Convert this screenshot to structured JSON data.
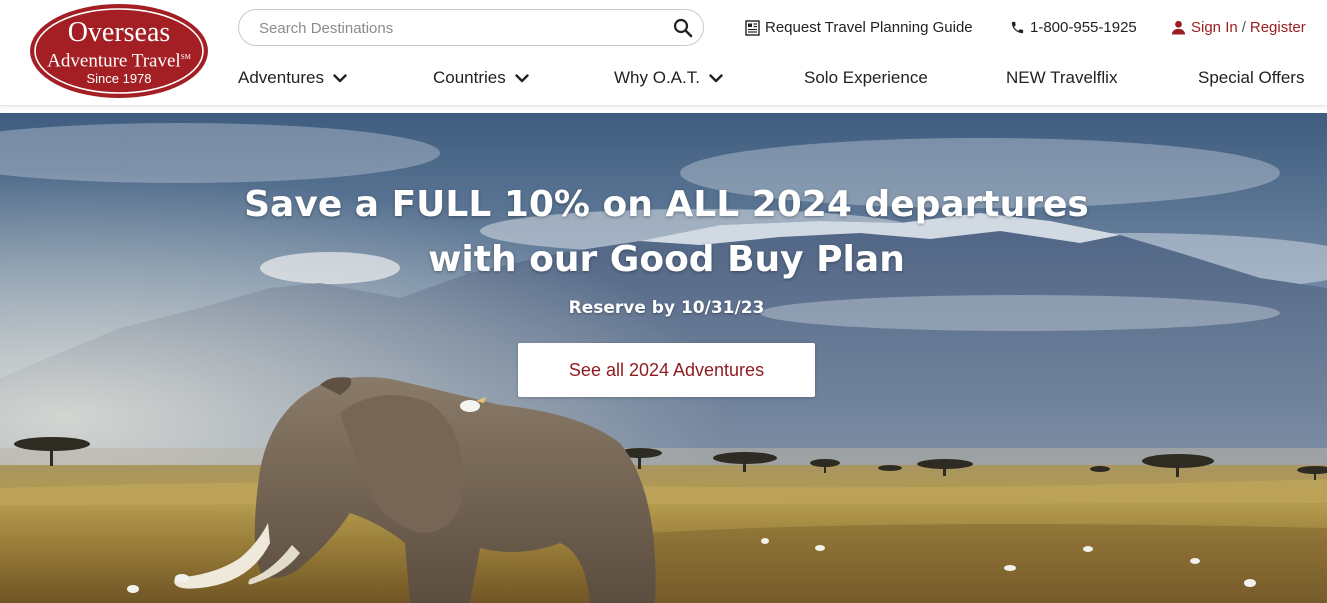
{
  "logo": {
    "line1": "Overseas",
    "line2": "Adventure Travel",
    "trademark": "SM",
    "line3": "Since 1978"
  },
  "search": {
    "placeholder": "Search Destinations",
    "value": ""
  },
  "utility": {
    "guide_label": "Request Travel Planning Guide",
    "phone": "1-800-955-1925",
    "sign_in": "Sign In",
    "separator": "/",
    "register": "Register"
  },
  "nav": {
    "adventures": "Adventures",
    "countries": "Countries",
    "why": "Why O.A.T.",
    "solo": "Solo Experience",
    "travelflix": "NEW Travelflix",
    "offers": "Special Offers"
  },
  "hero": {
    "title_line1": "Save a FULL 10% on ALL 2024 departures",
    "title_line2": "with our Good Buy Plan",
    "subtitle": "Reserve by 10/31/23",
    "cta_label": "See all 2024 Adventures"
  },
  "colors": {
    "brand_red": "#9a1f22",
    "cta_text": "#8e1b1e"
  },
  "icons": {
    "search": "magnifier",
    "guide": "newspaper",
    "phone": "phone-handset",
    "user": "person",
    "chevron": "chevron-down"
  }
}
